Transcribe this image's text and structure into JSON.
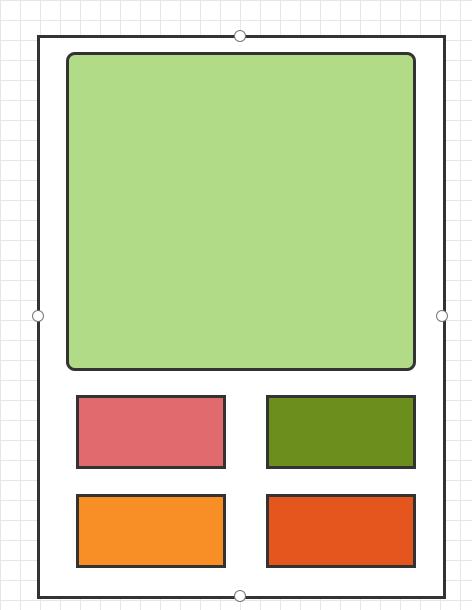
{
  "canvas": {
    "grid": true,
    "background_color": "#ffffff",
    "grid_color": "#e6e6e6"
  },
  "frame": {
    "fill": "#ffffff",
    "stroke": "#333333",
    "selected": true,
    "handles": [
      "top",
      "right",
      "bottom",
      "left"
    ]
  },
  "shapes": {
    "main_panel": {
      "fill": "#b2db87",
      "stroke": "#333333",
      "rounded": true
    },
    "tiles": [
      {
        "fill": "#e06a6d",
        "stroke": "#333333"
      },
      {
        "fill": "#6b8e1d",
        "stroke": "#333333"
      },
      {
        "fill": "#f78f26",
        "stroke": "#333333"
      },
      {
        "fill": "#e5561e",
        "stroke": "#333333"
      }
    ]
  }
}
